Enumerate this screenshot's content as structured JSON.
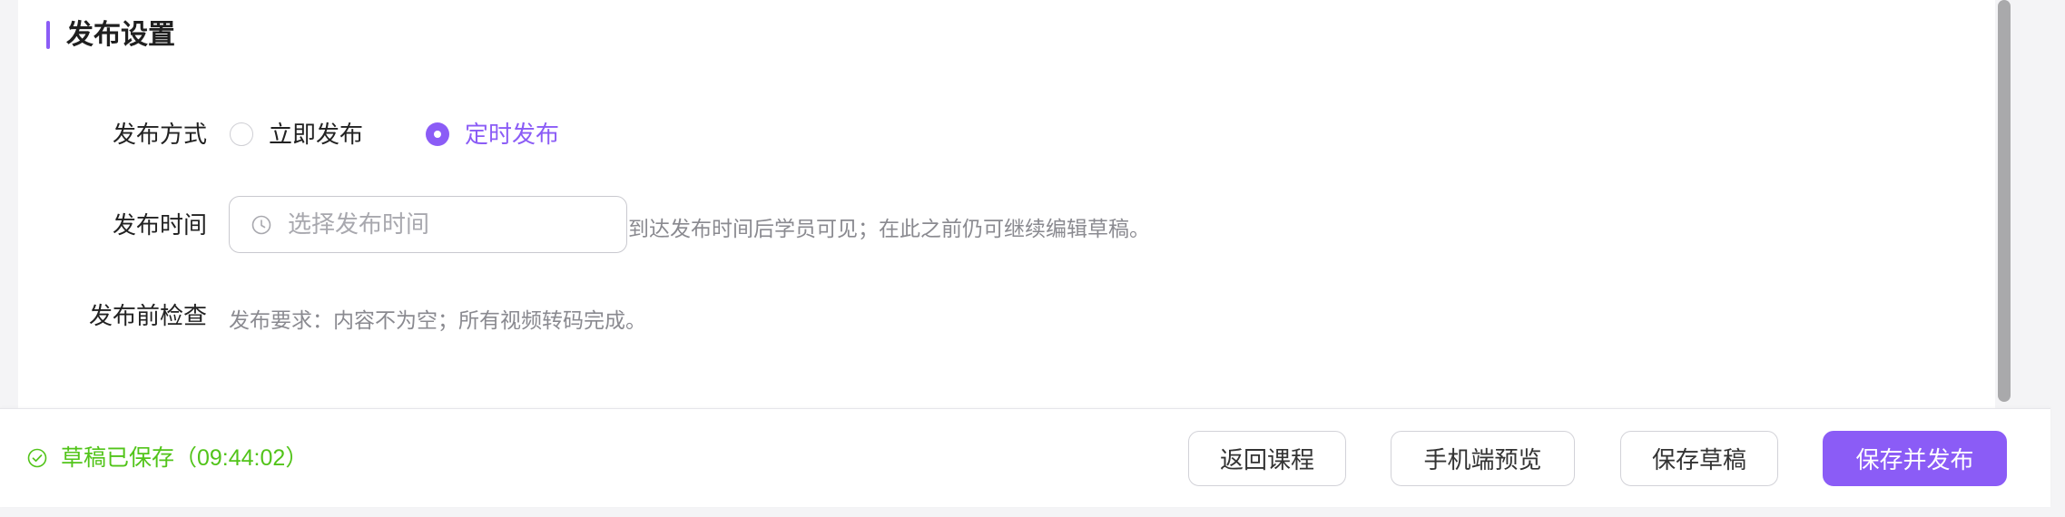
{
  "section": {
    "title": "发布设置"
  },
  "form": {
    "publish_mode": {
      "label": "发布方式",
      "options": [
        {
          "label": "立即发布",
          "selected": false
        },
        {
          "label": "定时发布",
          "selected": true
        }
      ]
    },
    "publish_time": {
      "label": "发布时间",
      "placeholder": "选择发布时间",
      "hint": "到达发布时间后学员可见；在此之前仍可继续编辑草稿。"
    },
    "precheck": {
      "label": "发布前检查",
      "text": "发布要求：内容不为空；所有视频转码完成。"
    }
  },
  "footer": {
    "save_status": "草稿已保存（09:44:02）",
    "buttons": [
      {
        "label": "返回课程"
      },
      {
        "label": "手机端预览"
      },
      {
        "label": "保存草稿"
      },
      {
        "label": "保存并发布"
      }
    ]
  },
  "icons": {
    "time_input": "clock-icon",
    "save_status": "check-circle-icon"
  },
  "colors": {
    "accent": "#8b5cf6",
    "success": "#52c41a"
  }
}
